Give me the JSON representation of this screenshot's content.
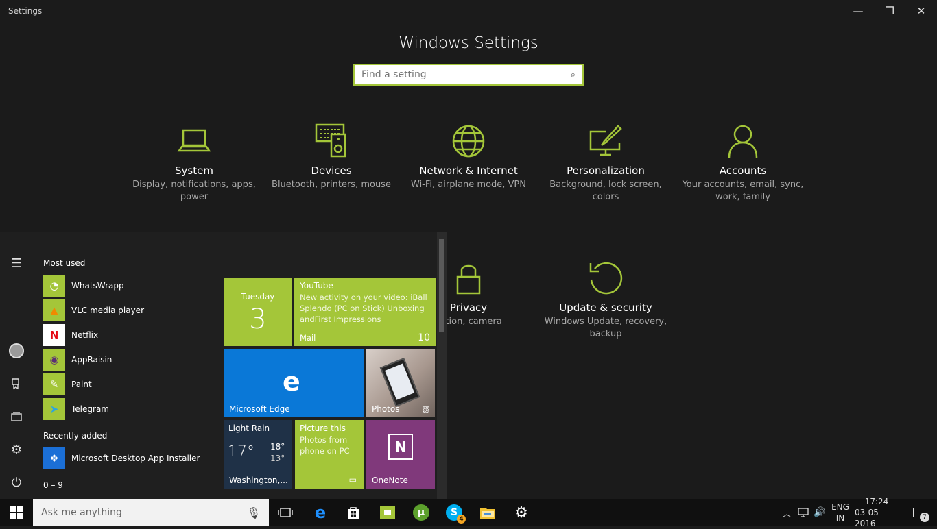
{
  "window": {
    "title": "Settings",
    "minimize_glyph": "—",
    "restore_glyph": "❐",
    "close_glyph": "✕"
  },
  "heading": "Windows Settings",
  "search": {
    "placeholder": "Find a setting",
    "icon": "search-icon"
  },
  "categories": [
    {
      "name": "System",
      "desc": "Display, notifications, apps, power",
      "icon": "laptop-icon"
    },
    {
      "name": "Devices",
      "desc": "Bluetooth, printers, mouse",
      "icon": "devices-icon"
    },
    {
      "name": "Network & Internet",
      "desc": "Wi-Fi, airplane mode, VPN",
      "icon": "globe-icon"
    },
    {
      "name": "Personalization",
      "desc": "Background, lock screen, colors",
      "icon": "paint-icon"
    },
    {
      "name": "Accounts",
      "desc": "Your accounts, email, sync, work, family",
      "icon": "person-icon"
    },
    {
      "name": "Privacy",
      "desc": "cation, camera",
      "icon": "lock-icon"
    },
    {
      "name": "Update & security",
      "desc": "Windows Update, recovery, backup",
      "icon": "refresh-icon"
    }
  ],
  "start_menu": {
    "rail_icons": [
      "hamburger-icon",
      "user-avatar-icon",
      "file-explorer-icon",
      "documents-icon",
      "gear-icon",
      "power-icon"
    ],
    "most_used_header": "Most used",
    "most_used": [
      {
        "label": "WhatsWrapp",
        "icon": "whatswrapp-icon",
        "glyph": "◔",
        "bg": "#a4c639"
      },
      {
        "label": "VLC media player",
        "icon": "vlc-cone-icon",
        "glyph": "▲",
        "bg": "#a4c639"
      },
      {
        "label": "Netflix",
        "icon": "netflix-icon",
        "glyph": "N",
        "bg": "#ffffff"
      },
      {
        "label": "AppRaisin",
        "icon": "appraisin-icon",
        "glyph": "◉",
        "bg": "#a4c639"
      },
      {
        "label": "Paint",
        "icon": "paint-palette-icon",
        "glyph": "✎",
        "bg": "#a4c639"
      },
      {
        "label": "Telegram",
        "icon": "telegram-icon",
        "glyph": "➤",
        "bg": "#a4c639"
      }
    ],
    "recently_added_header": "Recently added",
    "recently_added": [
      {
        "label": "Microsoft Desktop App Installer",
        "icon": "dropbox-icon",
        "glyph": "❖",
        "bg": "#1b6fd6"
      }
    ],
    "alpha_header": "0 – 9",
    "tiles": {
      "calendar": {
        "day": "Tuesday",
        "date": "3"
      },
      "mail": {
        "title": "YouTube",
        "body": "New activity on your video: iBall Splendo (PC on Stick) Unboxing andFirst Impressions",
        "label": "Mail",
        "count": "10"
      },
      "edge": {
        "label": "Microsoft Edge"
      },
      "photos": {
        "label": "Photos"
      },
      "weather": {
        "condition": "Light Rain",
        "temp": "17°",
        "high": "18°",
        "low": "13°",
        "location": "Washington,..."
      },
      "picture": {
        "title": "Picture this",
        "body": "Photos from phone on PC"
      },
      "onenote": {
        "label": "OneNote"
      }
    }
  },
  "taskbar": {
    "search_placeholder": "Ask me anything",
    "pinned": [
      "task-view-icon",
      "edge-icon",
      "store-icon",
      "messaging-icon",
      "utorrent-icon",
      "skype-icon",
      "file-explorer-icon",
      "settings-gear-icon"
    ],
    "skype_badge": "4",
    "lang_top": "ENG",
    "lang_bottom": "IN",
    "time": "17:24",
    "date": "03-05-2016",
    "notification_count": "7"
  },
  "colors": {
    "accent": "#a4c639",
    "edge_blue": "#0a78d7",
    "onenote_purple": "#80397b",
    "weather_bg": "#1f3147"
  }
}
